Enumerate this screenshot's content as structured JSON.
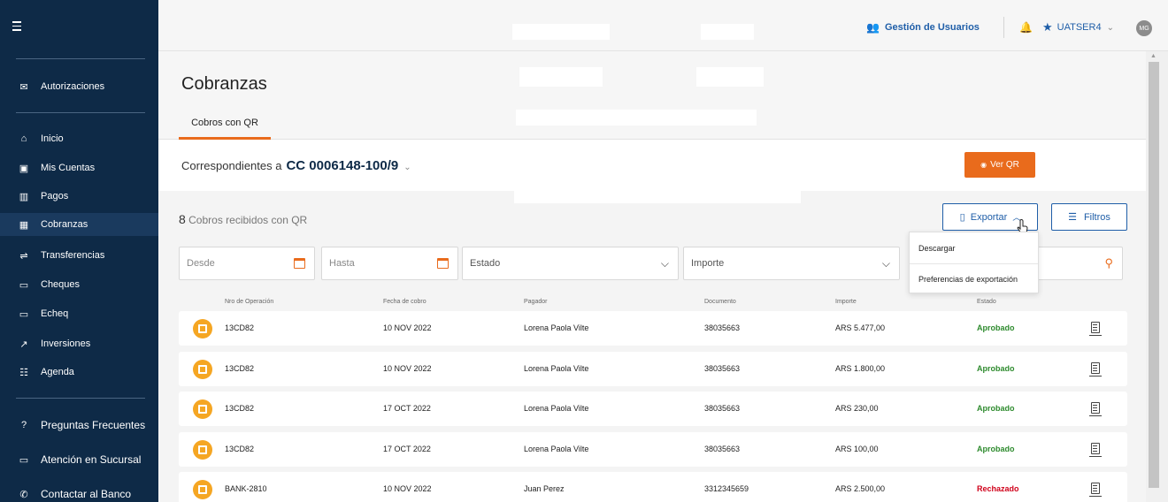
{
  "sidebar": {
    "items": [
      {
        "label": "Autorizaciones",
        "icon": "envelope-icon"
      },
      {
        "label": "Inicio",
        "icon": "home-icon"
      },
      {
        "label": "Mis Cuentas",
        "icon": "wallet-icon"
      },
      {
        "label": "Pagos",
        "icon": "barcode-icon"
      },
      {
        "label": "Cobranzas",
        "icon": "qr-icon",
        "active": true
      },
      {
        "label": "Transferencias",
        "icon": "arrows-icon"
      },
      {
        "label": "Cheques",
        "icon": "cheque-icon"
      },
      {
        "label": "Echeq",
        "icon": "echeq-icon"
      },
      {
        "label": "Inversiones",
        "icon": "chart-up-icon"
      },
      {
        "label": "Agenda",
        "icon": "contacts-icon"
      },
      {
        "label": "Preguntas Frecuentes",
        "icon": "help-icon"
      },
      {
        "label": "Atención en Sucursal",
        "icon": "monitor-icon"
      },
      {
        "label": "Contactar al Banco",
        "icon": "chat-icon"
      }
    ]
  },
  "topbar": {
    "gestion_label": "Gestión de Usuarios",
    "user_label": "UATSER4",
    "avatar_initials": "MG"
  },
  "header": {
    "title": "Cobranzas",
    "tab_label": "Cobros con QR"
  },
  "account": {
    "prefix": "Correspondientes a",
    "number": "CC 0006148-100/9",
    "verqr_label": "Ver QR"
  },
  "toolbar": {
    "count_number": "8",
    "count_text": "Cobros recibidos con QR",
    "exportar_label": "Exportar",
    "filtros_label": "Filtros"
  },
  "filters": {
    "desde": "Desde",
    "hasta": "Hasta",
    "estado": "Estado",
    "importe": "Importe"
  },
  "export_menu": {
    "descargar": "Descargar",
    "preferencias": "Preferencias de exportación"
  },
  "table": {
    "headers": {
      "operacion": "Nro de Operación",
      "fecha": "Fecha de cobro",
      "pagador": "Pagador",
      "documento": "Documento",
      "importe": "Importe",
      "estado": "Estado"
    },
    "rows": [
      {
        "op": "13CD82",
        "fecha": "10 NOV 2022",
        "pagador": "Lorena Paola Vilte",
        "documento": "38035663",
        "importe": "ARS 5.477,00",
        "estado": "Aprobado"
      },
      {
        "op": "13CD82",
        "fecha": "10 NOV 2022",
        "pagador": "Lorena Paola Vilte",
        "documento": "38035663",
        "importe": "ARS 1.800,00",
        "estado": "Aprobado"
      },
      {
        "op": "13CD82",
        "fecha": "17 OCT 2022",
        "pagador": "Lorena Paola Vilte",
        "documento": "38035663",
        "importe": "ARS 230,00",
        "estado": "Aprobado"
      },
      {
        "op": "13CD82",
        "fecha": "17 OCT 2022",
        "pagador": "Lorena Paola Vilte",
        "documento": "38035663",
        "importe": "ARS 100,00",
        "estado": "Aprobado"
      },
      {
        "op": "BANK-2810",
        "fecha": "10 NOV 2022",
        "pagador": "Juan Perez",
        "documento": "3312345659",
        "importe": "ARS 2.500,00",
        "estado": "Rechazado"
      }
    ]
  },
  "colors": {
    "sidebar_bg": "#0e2a47",
    "accent_orange": "#e96b1c",
    "link_blue": "#1f5ea8",
    "approved_green": "#2e8b2e",
    "rejected_red": "#d0021b"
  }
}
